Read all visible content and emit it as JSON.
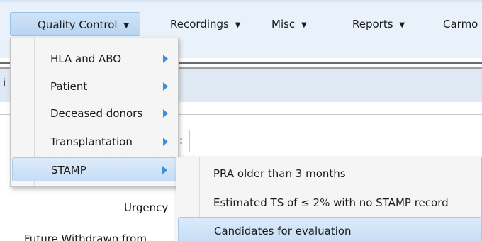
{
  "menubar": {
    "items": [
      {
        "label": "Quality Control",
        "caret": "▼"
      },
      {
        "label": "Recordings",
        "caret": "▼"
      },
      {
        "label": "Misc",
        "caret": "▼"
      },
      {
        "label": "Reports",
        "caret": "▼"
      },
      {
        "label": "Carmo"
      }
    ]
  },
  "quality_control_menu": {
    "items": [
      {
        "label": "HLA and ABO",
        "has_submenu": true
      },
      {
        "label": "Patient",
        "has_submenu": true
      },
      {
        "label": "Deceased donors",
        "has_submenu": true
      },
      {
        "label": "Transplantation",
        "has_submenu": true
      },
      {
        "label": "STAMP",
        "has_submenu": true
      }
    ]
  },
  "stamp_submenu": {
    "items": [
      {
        "label": "PRA older than 3 months"
      },
      {
        "label": "Estimated TS of ≤ 2% with no STAMP record"
      },
      {
        "label": "Candidates for evaluation"
      }
    ]
  },
  "background": {
    "left_fragment": "i",
    "colon": ":",
    "urgency_fragment": "Urgency",
    "withdrawn_fragment": "Future Withdrawn from"
  },
  "colors": {
    "menubar_bg": "#e9f2fb",
    "highlight": "#c6ddf5",
    "arrow": "#3d8fe0"
  }
}
